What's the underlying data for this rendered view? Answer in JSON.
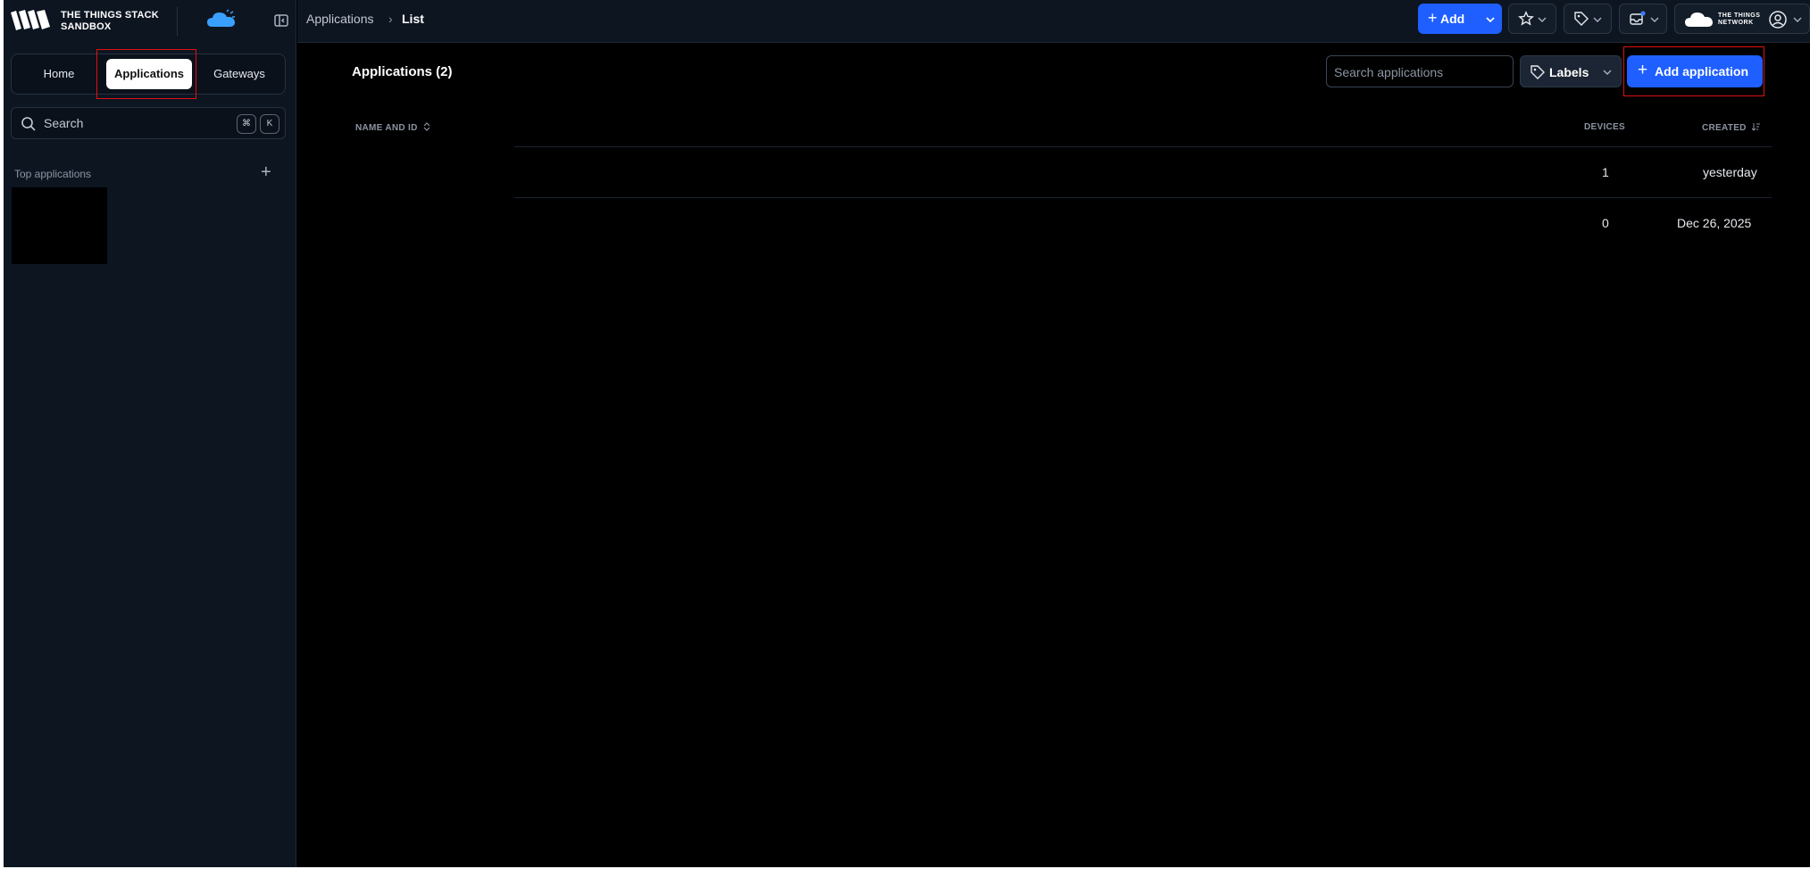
{
  "brand": {
    "line1": "THE THINGS STACK",
    "line2": "SANDBOX",
    "accent": "#1f5fff",
    "cloud_color": "#3aa0ff"
  },
  "nav": {
    "tabs": [
      {
        "label": "Home"
      },
      {
        "label": "Applications",
        "active": true
      },
      {
        "label": "Gateways"
      }
    ]
  },
  "sidebar": {
    "search_placeholder": "Search",
    "shortcut_cmd": "⌘",
    "shortcut_key": "K",
    "top_apps_label": "Top applications",
    "top_apps_add": "+"
  },
  "header": {
    "breadcrumb": [
      "Applications",
      "List"
    ],
    "breadcrumb_sep": "›",
    "add_label": "Add",
    "add_plus": "+",
    "ttn_text": "THE THINGS NETWORK",
    "icons": [
      "star-icon",
      "tag-icon",
      "inbox-icon",
      "user-circle-icon"
    ]
  },
  "main": {
    "title": "Applications (2)",
    "search_placeholder": "Search applications",
    "labels_button": "Labels",
    "add_button": "Add application",
    "add_plus": "+",
    "columns": {
      "name": "NAME AND ID",
      "devices": "DEVICES",
      "created": "CREATED"
    },
    "rows": [
      {
        "name": "",
        "devices": "1",
        "created": "yesterday"
      },
      {
        "name": "",
        "devices": "0",
        "created": "Dec 26, 2025"
      }
    ]
  }
}
